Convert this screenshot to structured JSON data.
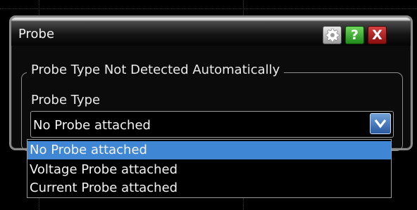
{
  "dialog": {
    "title": "Probe",
    "toolbar": {
      "help_label": "?",
      "close_label": "X"
    }
  },
  "group": {
    "legend": "Probe Type Not Detected Automatically"
  },
  "field": {
    "label": "Probe Type",
    "selected_value": "No Probe attached"
  },
  "dropdown": {
    "options": [
      {
        "label": "No Probe attached",
        "selected": true
      },
      {
        "label": "Voltage Probe attached",
        "selected": false
      },
      {
        "label": "Current Probe attached",
        "selected": false
      }
    ]
  },
  "colors": {
    "selection": "#3f86d4",
    "help_button": "#2fa82a",
    "close_button": "#b32020",
    "combo_arrow": "#3d6fb5"
  },
  "icons": {
    "settings": "gear-icon",
    "dropdown_arrow": "chevron-down-icon"
  }
}
